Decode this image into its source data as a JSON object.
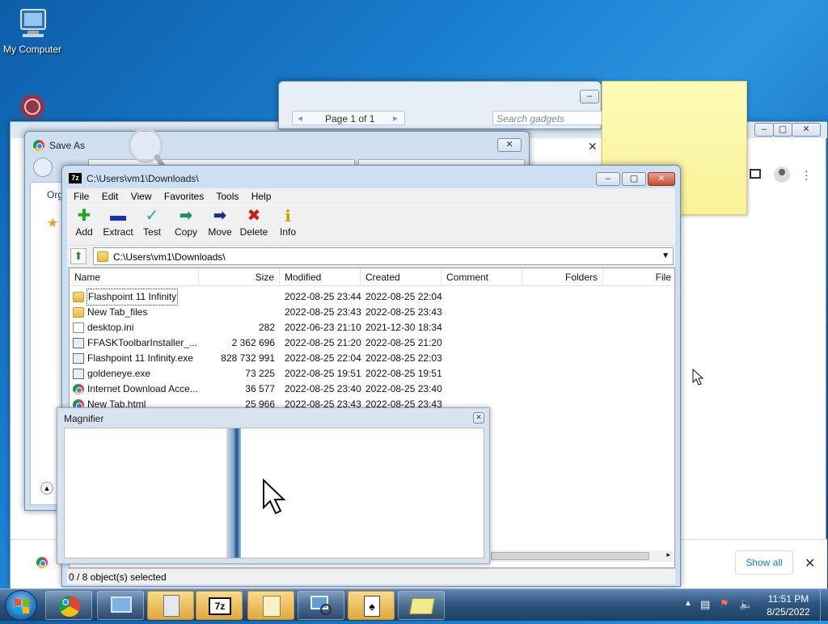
{
  "desktop": {
    "my_computer_label": "My Computer"
  },
  "gadgets_window": {
    "page_label": "Page 1 of 1",
    "search_placeholder": "Search gadgets"
  },
  "save_as": {
    "title": "Save As",
    "org_label": "Org"
  },
  "sevenzip": {
    "title": "C:\\Users\\vm1\\Downloads\\",
    "menu": [
      "File",
      "Edit",
      "View",
      "Favorites",
      "Tools",
      "Help"
    ],
    "toolbar": [
      "Add",
      "Extract",
      "Test",
      "Copy",
      "Move",
      "Delete",
      "Info"
    ],
    "address": "C:\\Users\\vm1\\Downloads\\",
    "columns": [
      "Name",
      "Size",
      "Modified",
      "Created",
      "Comment",
      "Folders",
      "File"
    ],
    "rows": [
      {
        "name": "Flashpoint 11 Infinity",
        "size": "",
        "modified": "2022-08-25 23:44",
        "created": "2022-08-25 22:04",
        "type": "folder"
      },
      {
        "name": "New Tab_files",
        "size": "",
        "modified": "2022-08-25 23:43",
        "created": "2022-08-25 23:43",
        "type": "folder"
      },
      {
        "name": "desktop.ini",
        "size": "282",
        "modified": "2022-06-23 21:10",
        "created": "2021-12-30 18:34",
        "type": "file"
      },
      {
        "name": "FFASKToolbarInstaller_...",
        "size": "2 362 696",
        "modified": "2022-08-25 21:20",
        "created": "2022-08-25 21:20",
        "type": "exe"
      },
      {
        "name": "Flashpoint 11 Infinity.exe",
        "size": "828 732 991",
        "modified": "2022-08-25 22:04",
        "created": "2022-08-25 22:03",
        "type": "exe"
      },
      {
        "name": "goldeneye.exe",
        "size": "73 225",
        "modified": "2022-08-25 19:51",
        "created": "2022-08-25 19:51",
        "type": "exe"
      },
      {
        "name": "Internet Download Acce...",
        "size": "36 577",
        "modified": "2022-08-25 23:40",
        "created": "2022-08-25 23:40",
        "type": "chrome"
      },
      {
        "name": "New Tab.html",
        "size": "25 966",
        "modified": "2022-08-25 23:43",
        "created": "2022-08-25 23:43",
        "type": "chrome"
      }
    ],
    "status": "0 / 8 object(s) selected"
  },
  "magnifier": {
    "title": "Magnifier"
  },
  "chrome_download_bar": {
    "show_all": "Show all"
  },
  "taskbar": {
    "time": "11:51 PM",
    "date": "8/25/2022"
  }
}
